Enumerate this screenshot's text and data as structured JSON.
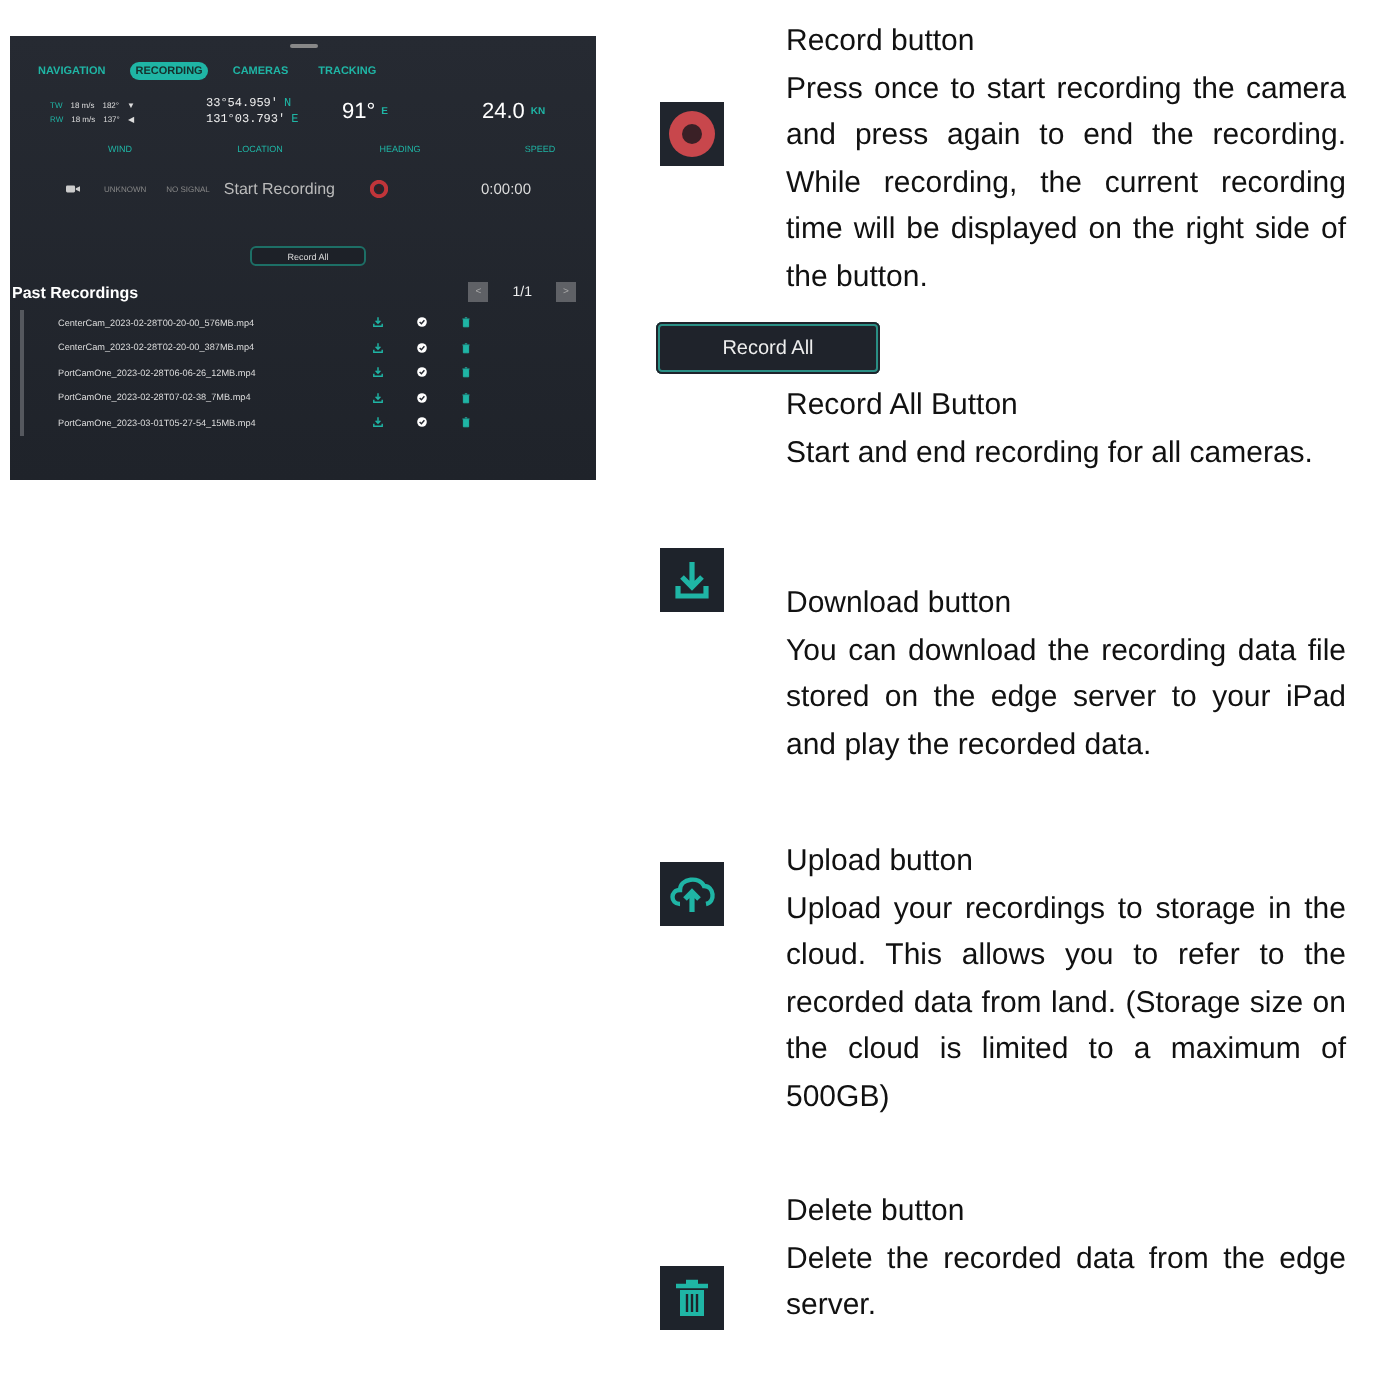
{
  "app_panel": {
    "tabs": [
      {
        "label": "NAVIGATION",
        "selected": false
      },
      {
        "label": "RECORDING",
        "selected": true
      },
      {
        "label": "CAMERAS",
        "selected": false
      },
      {
        "label": "TRACKING",
        "selected": false
      }
    ],
    "wind": [
      {
        "label": "TW",
        "speed": "18 m/s",
        "direction": "182°",
        "arrow": "▼"
      },
      {
        "label": "RW",
        "speed": "18 m/s",
        "direction": "137°",
        "arrow": "◀"
      }
    ],
    "location": {
      "lat": "33°54.959'",
      "lat_hemi": "N",
      "lon": "131°03.793'",
      "lon_hemi": "E"
    },
    "heading": {
      "value": "91°",
      "unit": "E"
    },
    "speed": {
      "value": "24.0",
      "unit": "KN"
    },
    "labels": [
      "WIND",
      "LOCATION",
      "HEADING",
      "SPEED"
    ],
    "camera": {
      "name": "UNKNOWN",
      "status": "NO SIGNAL",
      "action": "Start Recording",
      "time": "0:00:00"
    },
    "record_all": "Record All",
    "past": {
      "title": "Past Recordings",
      "prev": "<",
      "page": "1/1",
      "next": ">",
      "files": [
        "CenterCam_2023-02-28T00-20-00_576MB.mp4",
        "CenterCam_2023-02-28T02-20-00_387MB.mp4",
        "PortCamOne_2023-02-28T06-06-26_12MB.mp4",
        "PortCamOne_2023-02-28T07-02-38_7MB.mp4",
        "PortCamOne_2023-03-01T05-27-54_15MB.mp4"
      ]
    }
  },
  "sections": [
    {
      "kind": "record",
      "title": "Record button",
      "body": "Press once to start recording the camera and press again to end the recording. While recording, the current recording time will be displayed on the right side of the button."
    },
    {
      "kind": "record_all",
      "button_label": "Record All",
      "title": "Record All Button",
      "body": "Start and end recording for all cameras."
    },
    {
      "kind": "download",
      "title": "Download button",
      "body": "You can download the recording data file stored on the edge server to your iPad and play the recorded data."
    },
    {
      "kind": "upload",
      "title": "Upload button",
      "body": "Upload your recordings to storage in the cloud. This allows you to refer to the recorded data from land. (Storage size on the cloud is limited to a maximum of 500GB)"
    },
    {
      "kind": "delete",
      "title": "Delete button",
      "body": "Delete the recorded data from the edge server."
    }
  ]
}
